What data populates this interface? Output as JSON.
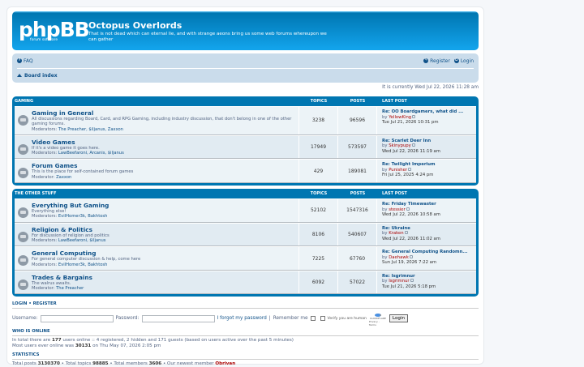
{
  "header": {
    "logo_text": "phpBB",
    "logo_sub": "forum software",
    "site_title": "Octopus Overlords",
    "site_desc": "That is not dead which can eternal lie, and with strange aeons bring us some web forums whereupon we can gather"
  },
  "nav": {
    "faq": "FAQ",
    "register": "Register",
    "login": "Login",
    "board_index": "Board index"
  },
  "current_time": "It is currently Wed Jul 22, 2026 11:28 am",
  "columns": {
    "topics": "TOPICS",
    "posts": "POSTS",
    "last_post": "LAST POST"
  },
  "categories": [
    {
      "title": "GAMING",
      "forums": [
        {
          "name": "Gaming in General",
          "desc": "All discussions regarding Board, Card, and RPG Gaming, including industry discussion, that don't belong in one of the other gaming forums.",
          "mod_label": "Moderators:",
          "mods": "The Preacher, $iljanus, Zaxxon",
          "topics": "3238",
          "posts": "96596",
          "lp_title": "Re: OO Boardgamers, what did ...",
          "lp_by": "by",
          "lp_author": "YellowKing",
          "lp_date": "Tue Jul 21, 2026 10:31 pm"
        },
        {
          "name": "Video Games",
          "desc": "If it's a video game it goes here.",
          "mod_label": "Moderators:",
          "mods": "LawBeefaroni, Arcanis, $iljanus",
          "topics": "17949",
          "posts": "573597",
          "lp_title": "Re: Scarlet Deer Inn",
          "lp_by": "by",
          "lp_author": "Skinypupy",
          "lp_date": "Wed Jul 22, 2026 11:19 am"
        },
        {
          "name": "Forum Games",
          "desc": "This is the place for self-contained forum games",
          "mod_label": "Moderator:",
          "mods": "Zaxxon",
          "topics": "429",
          "posts": "189081",
          "lp_title": "Re: Twilight Imperium",
          "lp_by": "by",
          "lp_author": "Punisher",
          "lp_date": "Fri Jul 25, 2025 4:24 pm"
        }
      ]
    },
    {
      "title": "THE OTHER STUFF",
      "forums": [
        {
          "name": "Everything But Gaming",
          "desc": "Everything else!",
          "mod_label": "Moderators:",
          "mods": "EvilHomer3k, Bakhtosh",
          "topics": "52102",
          "posts": "1547316",
          "lp_title": "Re: Friday Timewaster",
          "lp_by": "by",
          "lp_author": "stessier",
          "lp_date": "Wed Jul 22, 2026 10:58 am"
        },
        {
          "name": "Religion & Politics",
          "desc": "For discussion of religion and politics",
          "mod_label": "Moderators:",
          "mods": "LawBeefaroni, $iljanus",
          "topics": "8106",
          "posts": "540607",
          "lp_title": "Re: Ukraine",
          "lp_by": "by",
          "lp_author": "Kraken",
          "lp_date": "Wed Jul 22, 2026 11:02 am"
        },
        {
          "name": "General Computing",
          "desc": "For general computer discussion & help, come here",
          "mod_label": "Moderators:",
          "mods": "EvilHomer3k, Bakhtosh",
          "topics": "7225",
          "posts": "67760",
          "lp_title": "Re: General Computing Randomn...",
          "lp_by": "by",
          "lp_author": "Daehawk",
          "lp_date": "Sun Jul 19, 2026 7:22 am"
        },
        {
          "name": "Trades & Bargains",
          "desc": "The walrus awaits.",
          "mod_label": "Moderator:",
          "mods": "The Preacher",
          "topics": "6092",
          "posts": "57022",
          "lp_title": "Re: Isgrimnur",
          "lp_by": "by",
          "lp_author": "Isgrimnur",
          "lp_date": "Tue Jul 21, 2026 5:18 pm"
        }
      ]
    }
  ],
  "login_section": {
    "title_login": "LOGIN",
    "sep": "•",
    "title_register": "REGISTER",
    "username_label": "Username:",
    "password_label": "Password:",
    "forgot": "I forgot my password",
    "pipe": "|",
    "remember": "Remember me",
    "human": "Verify you are human",
    "captcha_brand": "CLOUDFLARE",
    "captcha_sub": "Privacy - Terms",
    "login_button": "Login"
  },
  "who_online": {
    "title": "WHO IS ONLINE",
    "line1_pre": "In total there are",
    "count": "177",
    "line1_post": "users online :: 4 registered, 2 hidden and 171 guests (based on users active over the past 5 minutes)",
    "line2_pre": "Most users ever online was",
    "max": "30131",
    "line2_post": "on Thu May 07, 2026 2:05 pm"
  },
  "statistics": {
    "title": "STATISTICS",
    "posts_label": "Total posts",
    "posts": "3130370",
    "topics_label": "• Total topics",
    "topics": "98885",
    "members_label": "• Total members",
    "members": "3606",
    "newest_label": "• Our newest member",
    "newest": "Obrivan"
  }
}
